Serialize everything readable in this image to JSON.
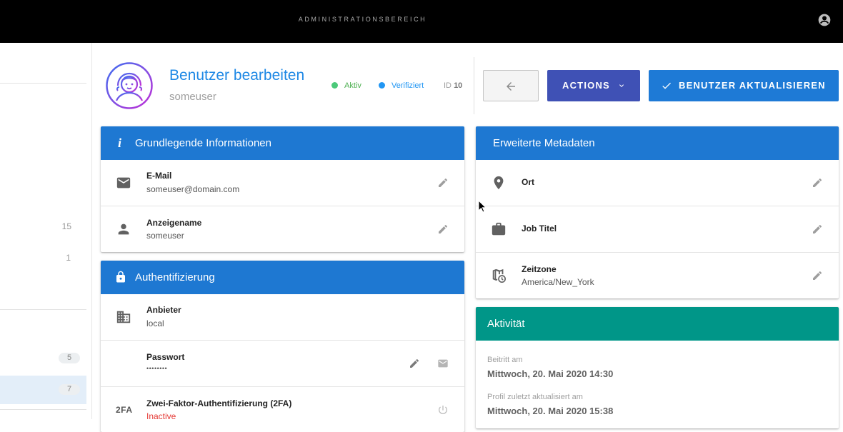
{
  "app": {
    "title": "ADMINISTRATIONSBEREICH",
    "icons": {
      "account": "account-circle-icon"
    }
  },
  "sidebar": {
    "counts": [
      "15",
      "1"
    ],
    "badges": [
      "5",
      "7"
    ]
  },
  "user": {
    "heading": "Benutzer bearbeiten",
    "username": "someuser",
    "status_active": "Aktiv",
    "status_verified": "Verifiziert",
    "id_label": "ID",
    "id_value": "10"
  },
  "toolbar": {
    "actions_label": "ACTIONS",
    "update_label": "BENUTZER AKTUALISIEREN"
  },
  "basic": {
    "title": "Grundlegende Informationen",
    "email_label": "E-Mail",
    "email_value": "someuser@domain.com",
    "display_label": "Anzeigename",
    "display_value": "someuser"
  },
  "auth": {
    "title": "Authentifizierung",
    "provider_label": "Anbieter",
    "provider_value": "local",
    "password_label": "Passwort",
    "password_value": "••••••••",
    "tfa_label": "Zwei-Faktor-Authentifizierung (2FA)",
    "tfa_value": "Inactive",
    "tfa_icon_text": "2FA"
  },
  "meta": {
    "title": "Erweiterte Metadaten",
    "location_label": "Ort",
    "job_label": "Job Titel",
    "tz_label": "Zeitzone",
    "tz_value": "America/New_York"
  },
  "activity": {
    "title": "Aktivität",
    "joined_label": "Beitritt am",
    "joined_value": "Mittwoch, 20. Mai 2020 14:30",
    "updated_label": "Profil zuletzt aktualisiert am",
    "updated_value": "Mittwoch, 20. Mai 2020 15:38"
  },
  "colors": {
    "primary": "#1e78d2",
    "title_blue": "#1e88e5",
    "actions": "#3f51b5",
    "teal": "#009688",
    "active_green": "#4caf50",
    "verified_blue": "#2196f3",
    "inactive_red": "#e53935"
  }
}
